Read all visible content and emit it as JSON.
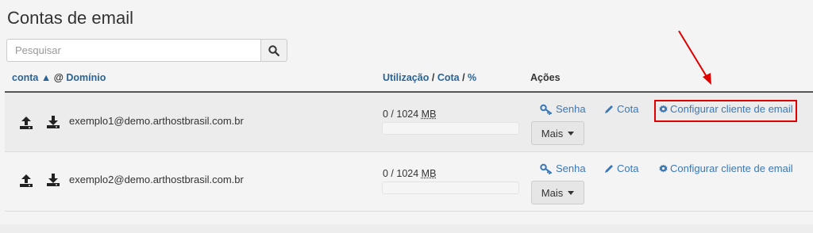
{
  "page": {
    "title": "Contas de email"
  },
  "search": {
    "placeholder": "Pesquisar",
    "icon": "search-icon"
  },
  "table": {
    "header": {
      "account": "conta",
      "sort_arrow": "▲",
      "at": "@",
      "domain": "Domínio",
      "usage": "Utilização",
      "sep1": "/",
      "quota": "Cota",
      "sep2": "/",
      "percent": "%",
      "actions": "Ações"
    },
    "rows": [
      {
        "email": "exemplo1@demo.arthostbrasil.com.br",
        "usage_text": "0 / 1024",
        "unit": "MB",
        "usage_fraction": 0,
        "password_label": "Senha",
        "quota_label": "Cota",
        "configure_label": "Configurar cliente de email",
        "more_label": "Mais"
      },
      {
        "email": "exemplo2@demo.arthostbrasil.com.br",
        "usage_text": "0 / 1024",
        "unit": "MB",
        "usage_fraction": 0,
        "password_label": "Senha",
        "quota_label": "Cota",
        "configure_label": "Configurar cliente de email",
        "more_label": "Mais"
      }
    ]
  },
  "colors": {
    "link": "#3a78b8",
    "highlight_box": "#e00000",
    "annotation_arrow": "#e00000"
  }
}
